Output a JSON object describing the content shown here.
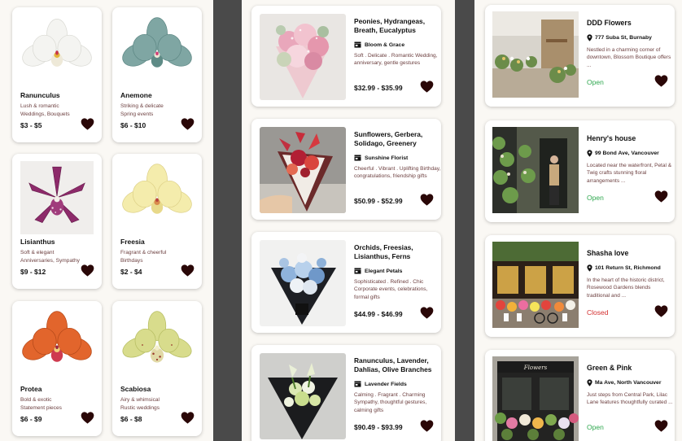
{
  "colors": {
    "heart": "#2a0707",
    "open": "#2fa84f",
    "closed": "#d32f2f",
    "description": "#6d4040"
  },
  "flowers": [
    {
      "name": "Ranunculus",
      "desc_line1": "Lush & romantic",
      "desc_line2": "Weddings, Bouquets",
      "price": "$3 - $5",
      "icon": "white-orchid-image"
    },
    {
      "name": "Anemone",
      "desc_line1": "Striking & delicate",
      "desc_line2": "Spring events",
      "price": "$6 - $10",
      "icon": "teal-orchid-image"
    },
    {
      "name": "Lisianthus",
      "desc_line1": "Soft & elegant",
      "desc_line2": "Anniversaries, Sympathy",
      "price": "$9 - $12",
      "icon": "purple-orchid-image"
    },
    {
      "name": "Freesia",
      "desc_line1": "Fragrant & cheerful",
      "desc_line2": "Birthdays",
      "price": "$2 - $4",
      "icon": "yellow-orchid-image"
    },
    {
      "name": "Protea",
      "desc_line1": "Bold & exotic",
      "desc_line2": "Statement pieces",
      "price": "$6 - $9",
      "icon": "orange-orchid-image"
    },
    {
      "name": "Scabiosa",
      "desc_line1": "Airy & whimsical",
      "desc_line2": "Rustic weddings",
      "price": "$6 - $8",
      "icon": "green-orchid-image"
    }
  ],
  "bouquets": [
    {
      "title": "Peonies, Hydrangeas, Breath, Eucalyptus",
      "shop": "Bloom & Grace",
      "desc": "Soft . Delicate . Romantic Wedding, anniversary, gentle gestures",
      "price": "$32.99 - $35.99",
      "icon": "pink-bouquet-image"
    },
    {
      "title": "Sunflowers, Gerbera, Solidago, Greenery",
      "shop": "Sunshine Florist",
      "desc": "Cheerful . Vibrant . Uplifting Birthday, congratulations, friendship gifts",
      "price": "$50.99 - $52.99",
      "icon": "red-bouquet-image"
    },
    {
      "title": "Orchids, Freesias, Lisianthus, Ferns",
      "shop": "Elegant Petals",
      "desc": "Sophisticated . Refined . Chic Corporate events, celebrations, formal gifts",
      "price": "$44.99 - $46.99",
      "icon": "blue-bouquet-image"
    },
    {
      "title": "Ranunculus, Lavender, Dahlias, Olive Branches",
      "shop": "Lavender Fields",
      "desc": "Calming . Fragrant . Charming Sympathy, thoughtful gestures, calming gifts",
      "price": "$90.49 - $93.99",
      "icon": "green-white-bouquet-image"
    }
  ],
  "shops": [
    {
      "name": "DDD Flowers",
      "address": "777 Suba St, Burnaby",
      "desc": "Nestled in a charming corner of downtown, Blossom Boutique offers ...",
      "status": "Open",
      "icon": "shop-interior-image"
    },
    {
      "name": "Henry's house",
      "address": "99 Bond Ave, Vancouver",
      "desc": "Located near the waterfront, Petal & Twig crafts stunning floral arrangements ...",
      "status": "Open",
      "icon": "shop-door-florist-image"
    },
    {
      "name": "Shasha love",
      "address": "101 Return St, Richmond",
      "desc": "In the heart of the historic district, Rosewood Gardens blends traditional and ...",
      "status": "Closed",
      "icon": "shop-storefront-image"
    },
    {
      "name": "Green & Pink",
      "address": "Ma Ave, North Vancouver",
      "desc": "Just steps from Central Park, Lilac Lane features thoughtfully curated ...",
      "status": "Open",
      "icon": "shop-black-front-image"
    }
  ],
  "shop_sign_text": "Flowers"
}
